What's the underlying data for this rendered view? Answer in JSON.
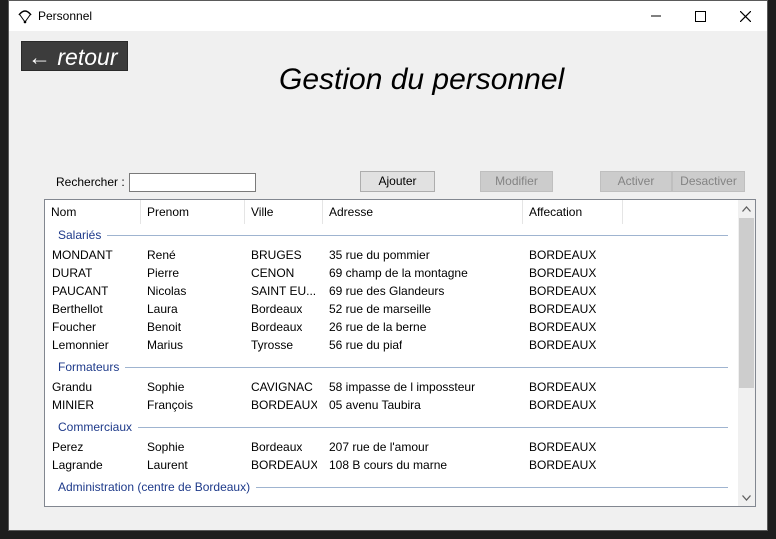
{
  "window": {
    "title": "Personnel",
    "back_label": "← retour",
    "page_title": "Gestion du personnel"
  },
  "toolbar": {
    "search_label": "Rechercher :",
    "search_value": "",
    "add_label": "Ajouter",
    "modify_label": "Modifier",
    "activate_label": "Activer",
    "deactivate_label": "Desactiver"
  },
  "list": {
    "columns": [
      "Nom",
      "Prenom",
      "Ville",
      "Adresse",
      "Affecation"
    ],
    "groups": [
      {
        "name": "Salariés",
        "rows": [
          [
            "MONDANT",
            "René",
            "BRUGES",
            "35 rue du pommier",
            "BORDEAUX"
          ],
          [
            "DURAT",
            "Pierre",
            "CENON",
            "69 champ de la montagne",
            "BORDEAUX"
          ],
          [
            "PAUCANT",
            "Nicolas",
            "SAINT EU...",
            "69 rue des Glandeurs",
            "BORDEAUX"
          ],
          [
            "Berthellot",
            "Laura",
            "Bordeaux",
            "52 rue de marseille",
            "BORDEAUX"
          ],
          [
            "Foucher",
            "Benoit",
            "Bordeaux",
            "26 rue de la berne",
            "BORDEAUX"
          ],
          [
            "Lemonnier",
            "Marius",
            "Tyrosse",
            "56 rue du piaf",
            "BORDEAUX"
          ]
        ]
      },
      {
        "name": "Formateurs",
        "rows": [
          [
            "Grandu",
            "Sophie",
            "CAVIGNAC",
            "58 impasse de l impossteur",
            "BORDEAUX"
          ],
          [
            "MINIER",
            "François",
            "BORDEAUX",
            "05 avenu Taubira",
            "BORDEAUX"
          ]
        ]
      },
      {
        "name": "Commerciaux",
        "rows": [
          [
            "Perez",
            "Sophie",
            "Bordeaux",
            "207 rue de l'amour",
            "BORDEAUX"
          ],
          [
            "Lagrande",
            "Laurent",
            "BORDEAUX",
            "108 B cours du marne",
            "BORDEAUX"
          ]
        ]
      },
      {
        "name": "Administration (centre de Bordeaux)",
        "rows": []
      }
    ]
  },
  "colors": {
    "group_header": "#1e3a8a",
    "disabled_button": "#cccccc",
    "back_button": "#3c3c3c"
  },
  "icons": {
    "app": "parachute-icon",
    "minimize": "minimize-icon",
    "maximize": "maximize-icon",
    "close": "close-icon",
    "scroll_up": "chevron-up-icon",
    "scroll_down": "chevron-down-icon"
  }
}
